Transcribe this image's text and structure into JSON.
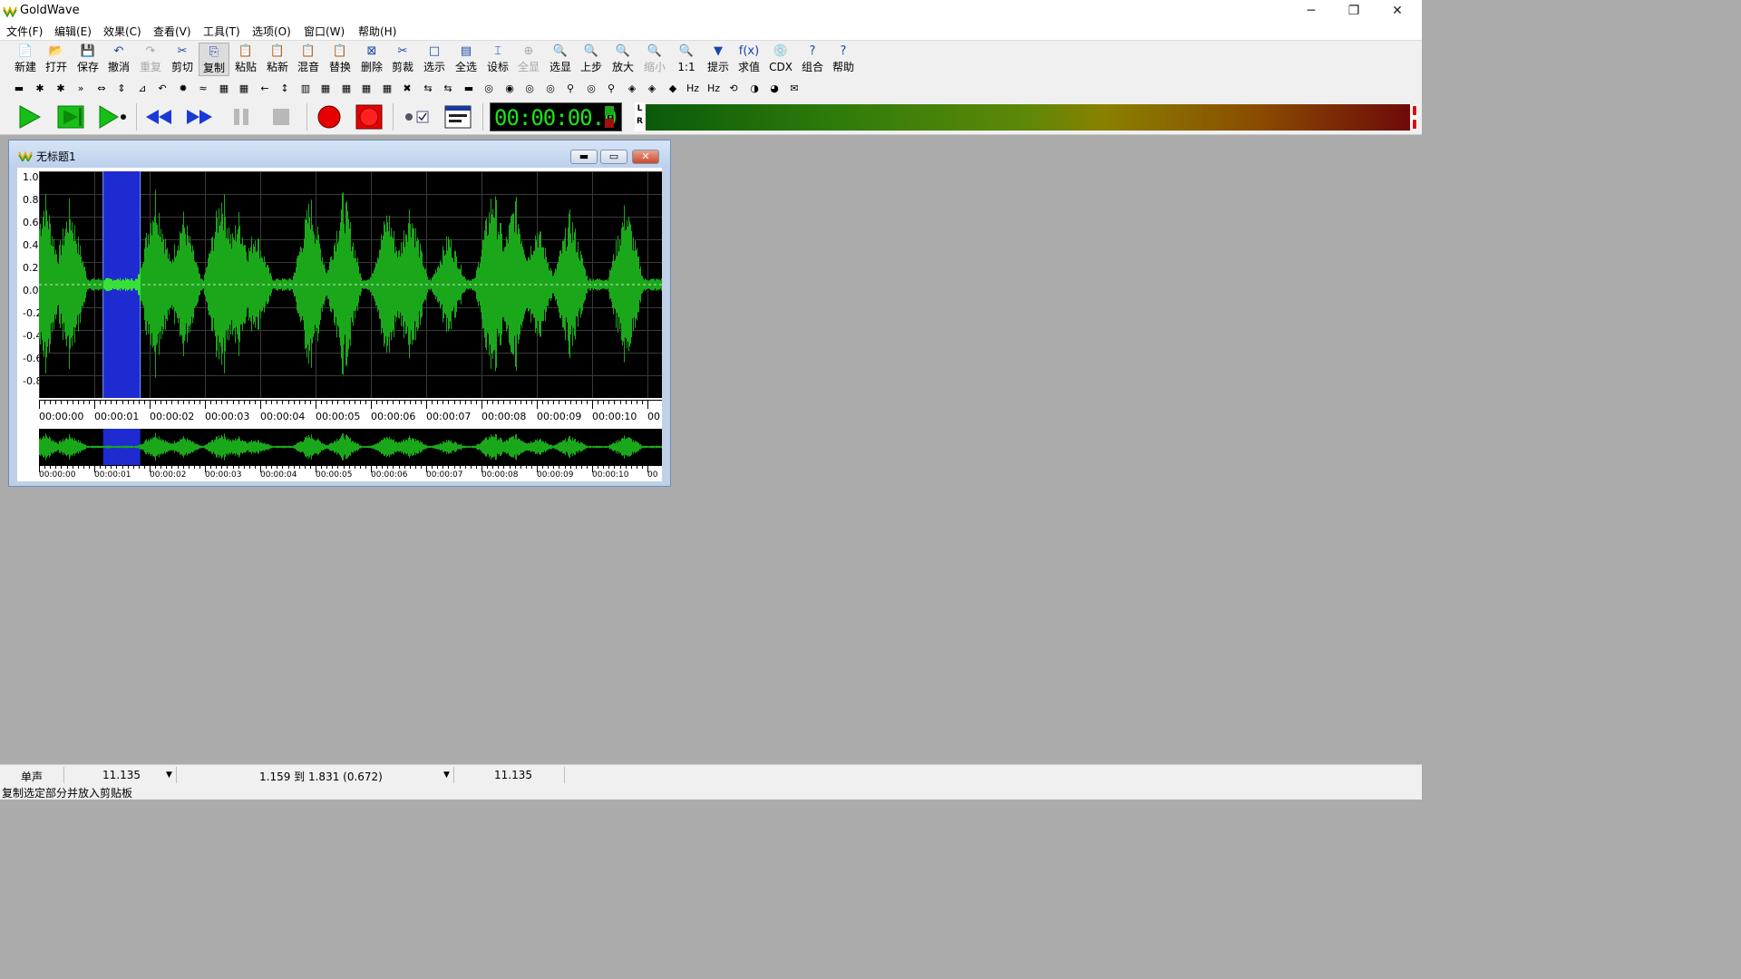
{
  "window": {
    "title": "GoldWave",
    "minimize": "─",
    "restore": "❐",
    "close": "✕"
  },
  "menu": [
    "文件(F)",
    "编辑(E)",
    "效果(C)",
    "查看(V)",
    "工具(T)",
    "选项(O)",
    "窗口(W)",
    "帮助(H)"
  ],
  "toolbar": [
    {
      "label": "新建",
      "icon": "📄"
    },
    {
      "label": "打开",
      "icon": "📂"
    },
    {
      "label": "保存",
      "icon": "💾"
    },
    {
      "label": "撤消",
      "icon": "↶"
    },
    {
      "label": "重复",
      "icon": "↷"
    },
    {
      "label": "剪切",
      "icon": "✂"
    },
    {
      "label": "复制",
      "icon": "⎘"
    },
    {
      "label": "粘贴",
      "icon": "📋"
    },
    {
      "label": "粘新",
      "icon": "📋"
    },
    {
      "label": "混音",
      "icon": "📋"
    },
    {
      "label": "替换",
      "icon": "📋"
    },
    {
      "label": "删除",
      "icon": "⊠"
    },
    {
      "label": "剪裁",
      "icon": "✂"
    },
    {
      "label": "选示",
      "icon": "□"
    },
    {
      "label": "全选",
      "icon": "▤"
    },
    {
      "label": "设标",
      "icon": "⌶"
    },
    {
      "label": "全显",
      "icon": "⊕"
    },
    {
      "label": "选显",
      "icon": "🔍"
    },
    {
      "label": "上步",
      "icon": "🔍"
    },
    {
      "label": "放大",
      "icon": "🔍"
    },
    {
      "label": "缩小",
      "icon": "🔍"
    },
    {
      "label": "1:1",
      "icon": "🔍"
    },
    {
      "label": "提示",
      "icon": "▼"
    },
    {
      "label": "求值",
      "icon": "f(x)"
    },
    {
      "label": "CDX",
      "icon": "💿"
    },
    {
      "label": "组合",
      "icon": "?"
    },
    {
      "label": "帮助",
      "icon": "?"
    }
  ],
  "effects_icons": [
    "▬",
    "✱",
    "✱",
    "»",
    "⇔",
    "⇕",
    "⊿",
    "↶",
    "✹",
    "≈",
    "▦",
    "▦",
    "←",
    "↕",
    "▥",
    "▦",
    "▦",
    "▦",
    "▦",
    "✖",
    "⇆",
    "⇆",
    "▬",
    "◎",
    "◉",
    "◎",
    "◎",
    "⚲",
    "◎",
    "⚲",
    "◈",
    "◈",
    "◆",
    "Hz",
    "Hz",
    "⟲",
    "◑",
    "◕",
    "✉"
  ],
  "transport": {
    "time": "00:00:00.0"
  },
  "meter": {
    "left_label": "L",
    "right_label": "R"
  },
  "document": {
    "title": "无标题1",
    "y_labels": [
      "1.0",
      "0.8",
      "0.6",
      "0.4",
      "0.2",
      "0.0",
      "-0.2",
      "-0.4",
      "-0.6",
      "-0.8"
    ],
    "time_labels": [
      "00:00:00",
      "00:00:01",
      "00:00:02",
      "00:00:03",
      "00:00:04",
      "00:00:05",
      "00:00:06",
      "00:00:07",
      "00:00:08",
      "00:00:09",
      "00:00:10",
      "00"
    ],
    "selection": {
      "start_seconds": 1.159,
      "end_seconds": 1.831
    },
    "duration_seconds": 11.135,
    "colors": {
      "wave": "#1aa81a",
      "selection": "#1e2bd0",
      "background": "#000000"
    }
  },
  "status": {
    "channel": "单声",
    "length": "11.135",
    "selection": "1.159 到 1.831 (0.672)",
    "position": "11.135"
  },
  "hint": "复制选定部分并放入剪贴板"
}
